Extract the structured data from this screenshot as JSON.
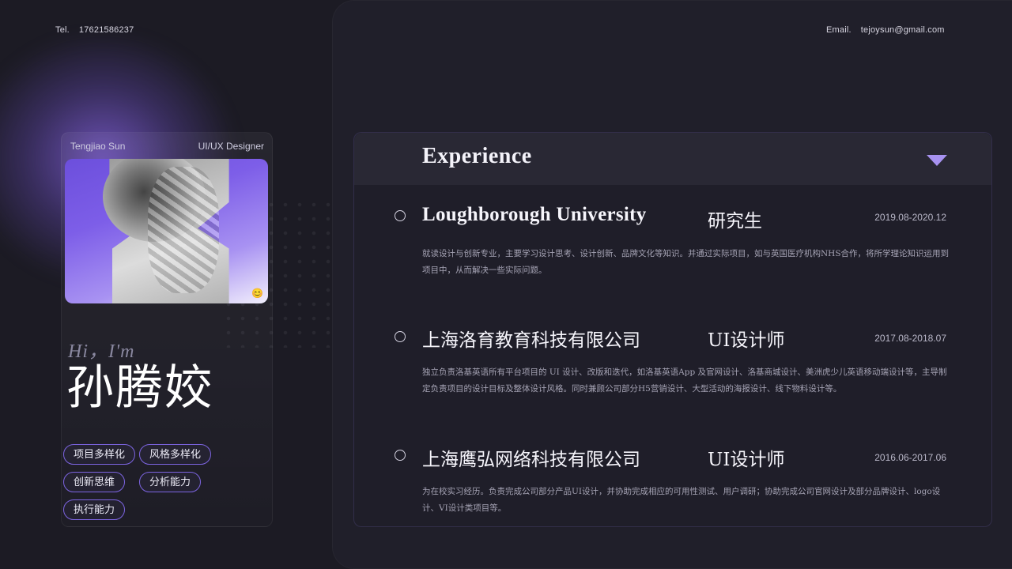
{
  "header": {
    "tel_label": "Tel.",
    "tel_value": "17621586237",
    "email_label": "Email.",
    "email_value": "tejoysun@gmail.com"
  },
  "profile": {
    "name_en": "Tengjiao Sun",
    "role": "UI/UX Designer",
    "photo_emoji": "😊",
    "greeting": "Hi，I'm",
    "name_cn": "孙腾姣",
    "tags": [
      "项目多样化",
      "风格多样化",
      "创新思维",
      "分析能力",
      "执行能力"
    ]
  },
  "experience": {
    "title": "Experience",
    "entries": [
      {
        "org": "Loughborough University",
        "role": "研究生",
        "date": "2019.08-2020.12",
        "desc": "就读设计与创新专业，主要学习设计思考、设计创新、品牌文化等知识。并通过实际项目，如与英国医疗机构NHS合作，将所学理论知识运用到项目中，从而解决一些实际问题。"
      },
      {
        "org": "上海洛育教育科技有限公司",
        "role": "UI设计师",
        "date": "2017.08-2018.07",
        "desc": "独立负责洛基英语所有平台项目的 UI 设计、改版和迭代，如洛基英语App 及官网设计、洛基商城设计、美洲虎少儿英语移动端设计等，主导制定负责项目的设计目标及整体设计风格。同时兼顾公司部分H5营销设计、大型活动的海报设计、线下物料设计等。"
      },
      {
        "org": "上海鹰弘网络科技有限公司",
        "role": "UI设计师",
        "date": "2016.06-2017.06",
        "desc": "为在校实习经历。负责完成公司部分产品UI设计，并协助完成相应的可用性测试、用户调研；协助完成公司官网设计及部分品牌设计、logo设计、VI设计类项目等。"
      }
    ]
  },
  "colors": {
    "background": "#1c1b24",
    "accent": "#7c64e0",
    "triangle": "#a792f0"
  }
}
